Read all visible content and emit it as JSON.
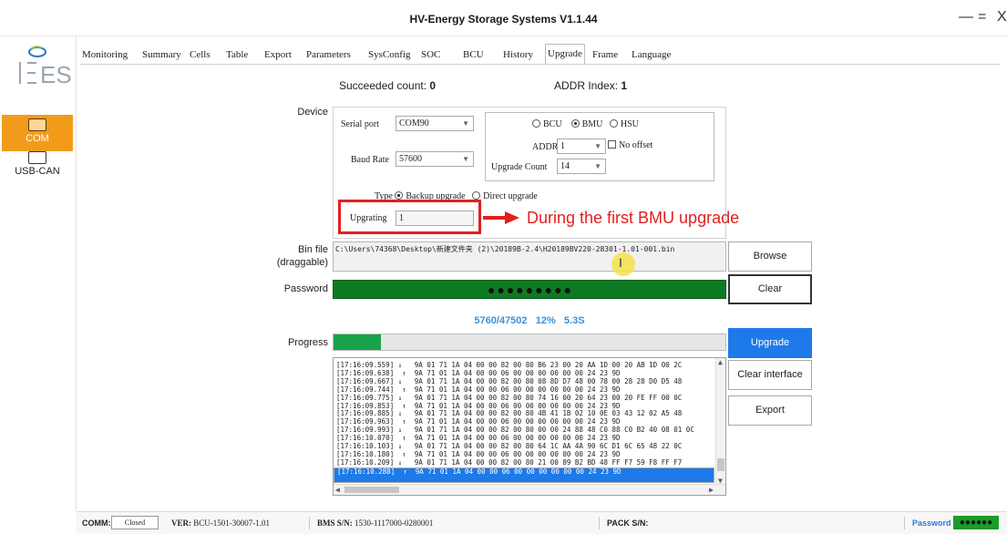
{
  "window": {
    "title": "HV-Energy Storage Systems V1.1.44",
    "min": "—",
    "max": "=",
    "close": "X"
  },
  "sidebar": {
    "logo_text": "ES",
    "items": [
      {
        "label": "COM",
        "active": true,
        "icon": "serial-port-icon"
      },
      {
        "label": "USB-CAN",
        "active": false,
        "icon": "usb-can-icon"
      }
    ]
  },
  "tabs": [
    "Monitoring",
    "Summary",
    "Cells",
    "Table",
    "Export",
    "Parameters",
    "SysConfig",
    "SOC",
    "BCU",
    "History",
    "Upgrade",
    "Frame",
    "Language"
  ],
  "active_tab": "Upgrade",
  "stats": {
    "succeeded_label": "Succeeded count:",
    "succeeded_value": "0",
    "addr_label": "ADDR Index:",
    "addr_value": "1"
  },
  "device": {
    "label": "Device",
    "serial_port_label": "Serial port",
    "serial_port_value": "COM90",
    "baud_rate_label": "Baud Rate",
    "baud_rate_value": "57600",
    "target_options": [
      "BCU",
      "BMU",
      "HSU"
    ],
    "target_selected": "BMU",
    "addr_label": "ADDR",
    "addr_value": "1",
    "no_offset_label": "No offset",
    "upgrade_count_label": "Upgrade Count",
    "upgrade_count_value": "14",
    "type_label": "Type",
    "type_options": [
      "Backup upgrade",
      "Direct upgrade"
    ],
    "type_selected": "Backup upgrade",
    "upgrating_label": "Upgrating",
    "upgrating_value": "1"
  },
  "annotation": {
    "text": "During the first BMU upgrade",
    "color": "#e02020"
  },
  "bin_file": {
    "label_line1": "Bin file",
    "label_line2": "(draggable)",
    "path": "C:\\Users\\74368\\Desktop\\新建文件夹 (2)\\20189B-2.4\\H20189BV220-28301-1.01-001.bin",
    "browse_label": "Browse"
  },
  "password": {
    "label": "Password",
    "dots": "●●●●●●●●●",
    "clear_label": "Clear",
    "color": "#0f7a24"
  },
  "progress": {
    "label": "Progress",
    "bytes": "5760/47502",
    "percent_text": "12%",
    "time": "5.3S",
    "fraction": 0.12
  },
  "buttons": {
    "upgrade": "Upgrade",
    "clear_interface": "Clear interface",
    "export": "Export"
  },
  "log_lines": [
    "[17:16:09.559] ↓   9A 01 71 1A 04 00 00 82 00 80 B6 23 00 20 AA 1D 00 20 AB 1D 00 2C",
    "[17:16:09.638]  ↑  9A 71 01 1A 04 00 00 06 00 00 00 00 00 00 24 23 9D",
    "[17:16:09.667] ↓   9A 01 71 1A 04 00 00 82 00 80 08 8D D7 48 00 78 00 28 28 D0 D5 48",
    "[17:16:09.744]  ↑  9A 71 01 1A 04 00 00 06 00 00 00 00 00 00 24 23 9D",
    "[17:16:09.775] ↓   9A 01 71 1A 04 00 00 82 00 80 74 16 00 20 64 23 00 20 FE FF 00 0C",
    "[17:16:09.853]  ↑  9A 71 01 1A 04 00 00 06 00 00 00 00 00 00 24 23 9D",
    "[17:16:09.885] ↓   9A 01 71 1A 04 00 00 82 00 80 4B 41 1B 02 10 0E 03 43 12 02 A5 48",
    "[17:16:09.963]  ↑  9A 71 01 1A 04 00 00 06 00 00 00 00 00 00 24 23 9D",
    "[17:16:09.993] ↓   9A 01 71 1A 04 00 00 82 00 80 00 00 24 88 48 C0 88 C0 B2 40 08 01 0C",
    "[17:16:10.070]  ↑  9A 71 01 1A 04 00 00 06 00 00 00 00 00 00 24 23 9D",
    "[17:16:10.103] ↓   9A 01 71 1A 04 00 00 82 00 80 64 1C AA 4A 90 6C D1 6C 65 48 22 0C",
    "[17:16:10.180]  ↑  9A 71 01 1A 04 00 00 06 00 00 00 00 00 00 24 23 9D",
    "[17:16:10.209] ↓   9A 01 71 1A 04 00 00 82 00 80 21 00 89 B2 BD 48 FF F7 59 F8 FF F7",
    "[17:16:10.288]  ↑  9A 71 01 1A 04 00 00 06 00 00 00 00 00 00 24 23 9D"
  ],
  "status": {
    "comm_label": "COMM:",
    "comm_value": "Closed",
    "ver_label": "VER:",
    "ver_value": "BCU-1501-30007-1.01",
    "bms_sn_label": "BMS S/N:",
    "bms_sn_value": "1530-1117000-0280001",
    "pack_sn_label": "PACK S/N:",
    "pack_sn_value": "",
    "password_label": "Password",
    "password_dots": "●●●●●●"
  }
}
